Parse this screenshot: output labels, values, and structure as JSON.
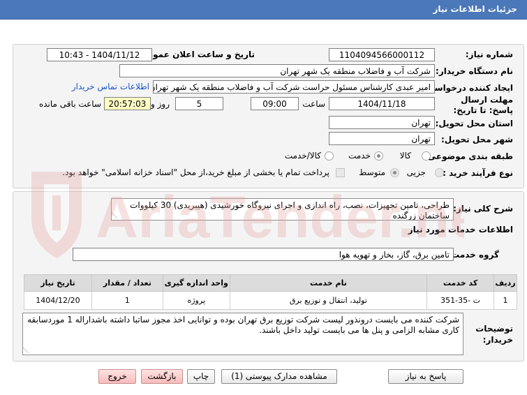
{
  "header": {
    "title": "جزئیات اطلاعات نیاز"
  },
  "fields": {
    "need_number_label": "شماره نیاز:",
    "need_number": "1104094566000112",
    "announce_label": "تاریخ و ساعت اعلان عمومی:",
    "announce_value": "1404/11/12 - 10:43",
    "buyer_org_label": "نام دستگاه خریدار:",
    "buyer_org": "شرکت آب و فاضلاب منطقه یک شهر تهران",
    "requester_label": "ایجاد کننده درخواست:",
    "requester": "امیر عبدی کارشناس مسئول حراست شرکت آب و فاضلاب منطقه یک شهر تهران",
    "contact_link": "اطلاعات تماس خریدار",
    "deadline_label": "مهلت ارسال پاسخ: تا تاریخ:",
    "deadline_date": "1404/11/18",
    "time_label": "ساعت",
    "deadline_time": "09:00",
    "days_value": "5",
    "days_label": "روز و",
    "remaining_time": "20:57:03",
    "remaining_label": "ساعت باقی مانده",
    "province_label": "استان محل تحویل:",
    "province": "تهران",
    "city_label": "شهر محل تحویل:",
    "city": "تهران",
    "category_label": "طبقه بندی موضوعی:",
    "category_options": [
      "کالا",
      "خدمت",
      "کالا/خدمت"
    ],
    "process_label": "نوع فرآیند خرید :",
    "process_options": [
      "جزیی",
      "متوسط"
    ],
    "payment_note": "پرداخت تمام یا بخشی از مبلغ خرید،از محل \"اسناد خزانه اسلامی\" خواهد بود."
  },
  "summary": {
    "label": "شرح کلی نیاز:",
    "text": "طراحی، تامین تجهیزات، نصب، راه اندازی و اجرای نیروگاه خورشیدی (هیبریدی) 30 کیلووات ساختمان زرگنده"
  },
  "services": {
    "section_title": "اطلاعات خدمات مورد نیاز",
    "group_label": "گروه خدمت:",
    "group_value": "تامین برق، گاز، بخار و تهویه هوا",
    "columns": [
      "ردیف",
      "کد خدمت",
      "نام خدمت",
      "واحد اندازه گیری",
      "تعداد / مقدار",
      "تاریخ نیاز"
    ],
    "rows": [
      {
        "row": "1",
        "code": "ت -35-351",
        "name": "تولید، انتقال و توزیع برق",
        "unit": "پروژه",
        "qty": "1",
        "date": "1404/12/20"
      }
    ]
  },
  "buyer_notes": {
    "label": "توضیحات خریدار:",
    "text": "شرکت کننده می بایست درونذور لیست شرکت توزیع برق تهران بوده و توانایی اخذ مجوز ساتبا داشته باشداراله 1 موردسابقه کاری مشابه الزامی و پنل ها می بایست تولید داخل باشند."
  },
  "buttons": {
    "reply": "پاسخ به نیاز",
    "attachments": "مشاهده مدارک پیوستی (1)",
    "print": "چاپ",
    "back": "بازگشت",
    "exit": "خروج"
  },
  "watermark": {
    "text": "AriaTender.net"
  },
  "colors": {
    "header": "#4a78b8",
    "watermark": "#e5a5a5",
    "panel": "#f4f4f4"
  }
}
